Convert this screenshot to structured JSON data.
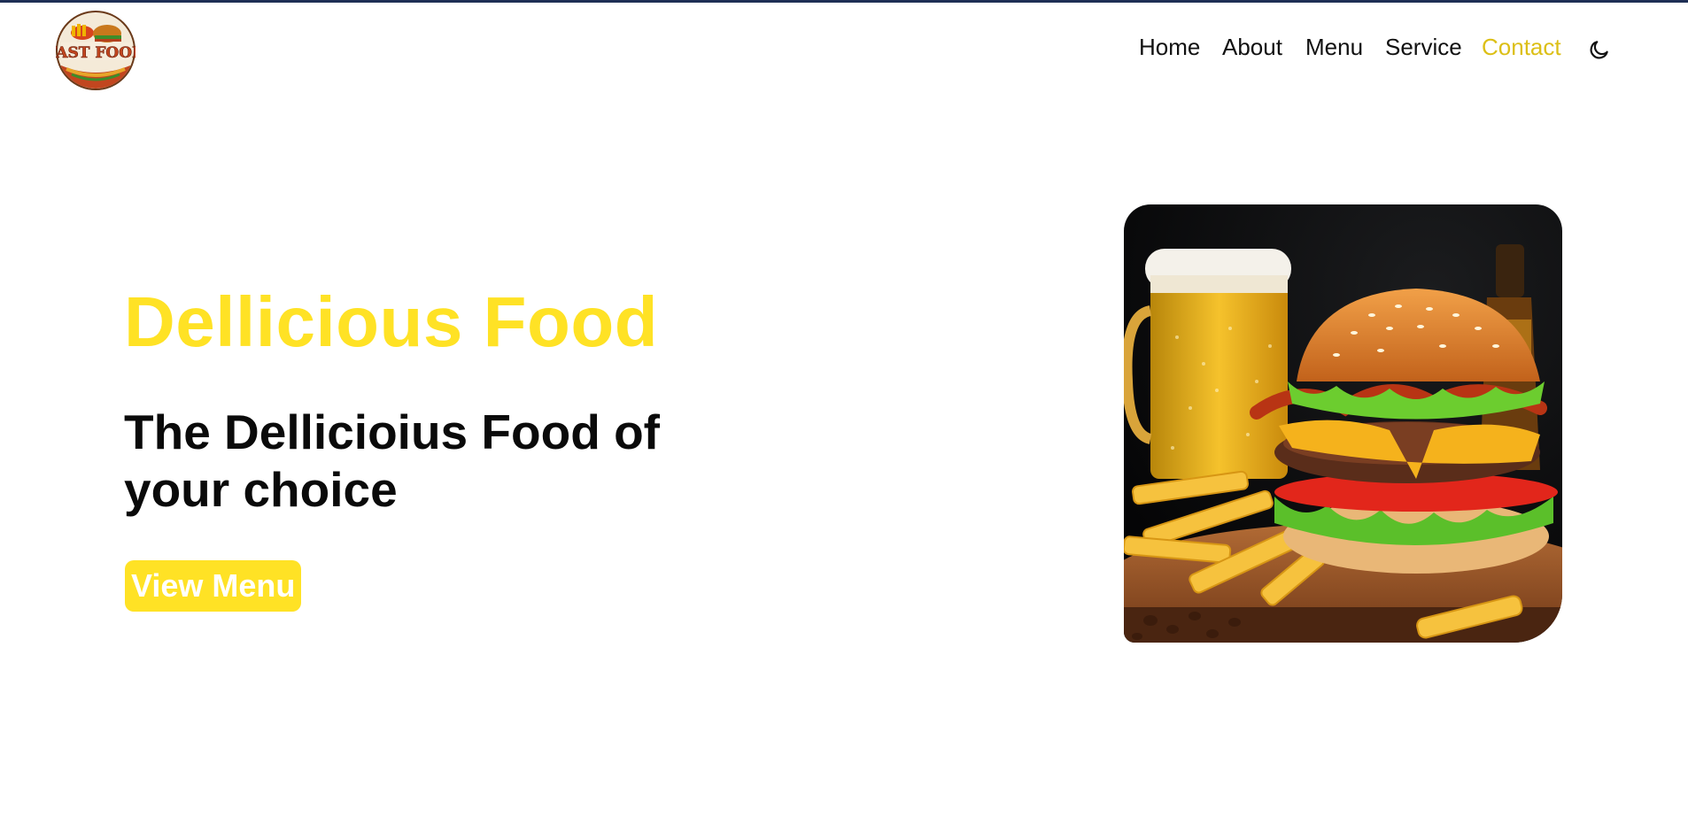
{
  "logo": {
    "text": "FAST FOOD"
  },
  "nav": {
    "items": [
      {
        "label": "Home",
        "active": false
      },
      {
        "label": "About",
        "active": false
      },
      {
        "label": "Menu",
        "active": false
      },
      {
        "label": "Service",
        "active": false
      },
      {
        "label": "Contact",
        "active": true
      }
    ],
    "theme_toggle_icon": "moon-icon"
  },
  "hero": {
    "title": "Dellicious Food",
    "subtitle": "The Dellicioius Food of your choice",
    "button_label": "View Menu",
    "image_icon": "burger-photo"
  },
  "colors": {
    "accent_yellow": "#ffe225",
    "nav_active": "#dcbf16",
    "text_dark": "#0a0a0a",
    "top_strip": "#1e2f55"
  }
}
